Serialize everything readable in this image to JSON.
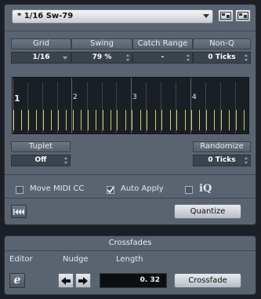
{
  "preset": {
    "value": "* 1/16  Sw-79"
  },
  "params": {
    "grid": {
      "label": "Grid",
      "value": "1/16"
    },
    "swing": {
      "label": "Swing",
      "value": "79 %"
    },
    "catch_range": {
      "label": "Catch Range",
      "value": "-"
    },
    "non_q": {
      "label": "Non-Q",
      "value": "0 Ticks"
    }
  },
  "grid_display": {
    "bars": [
      "1",
      "2",
      "3",
      "4"
    ]
  },
  "tuplet": {
    "label": "Tuplet",
    "value": "Off"
  },
  "randomize": {
    "label": "Randomize",
    "value": "0 Ticks"
  },
  "options": {
    "move_midi_cc": {
      "label": "Move MIDI CC",
      "checked": false
    },
    "auto_apply": {
      "label": "Auto Apply",
      "checked": true
    },
    "iq": {
      "label": "iQ",
      "checked": false
    }
  },
  "actions": {
    "quantize_label": "Quantize"
  },
  "crossfades": {
    "title": "Crossfades",
    "editor_label": "Editor",
    "nudge_label": "Nudge",
    "length_label": "Length",
    "length_value": "0. 32",
    "button_label": "Crossfade"
  },
  "colors": {
    "accent_yellow": "#c9d160",
    "panel": "#5a6470",
    "background": "#1c2026"
  }
}
